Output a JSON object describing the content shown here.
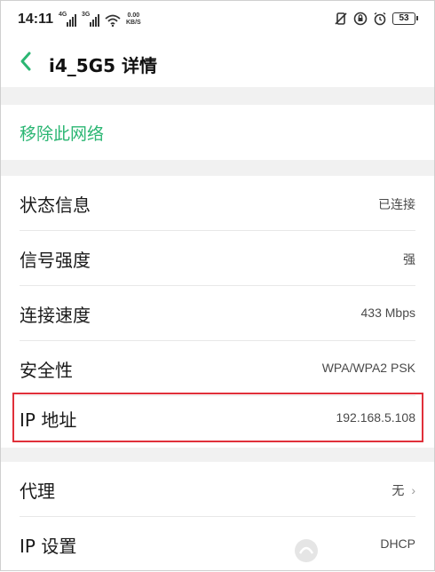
{
  "status_bar": {
    "time": "14:11",
    "sim1_network": "4G",
    "sim2_network": "3G",
    "speed_value": "0.00",
    "speed_unit": "KB/S",
    "battery": "53"
  },
  "header": {
    "title": "i4_5G5 详情"
  },
  "actions": {
    "remove_network": "移除此网络"
  },
  "details": [
    {
      "label": "状态信息",
      "value": "已连接"
    },
    {
      "label": "信号强度",
      "value": "强"
    },
    {
      "label": "连接速度",
      "value": "433 Mbps"
    },
    {
      "label": "安全性",
      "value": "WPA/WPA2 PSK"
    },
    {
      "label": "IP 地址",
      "value": "192.168.5.108"
    }
  ],
  "settings": [
    {
      "label": "代理",
      "value": "无"
    },
    {
      "label": "IP 设置",
      "value": "DHCP"
    }
  ],
  "colors": {
    "accent": "#2bb673",
    "highlight_border": "#e0303a",
    "band": "#f1f1f1"
  }
}
